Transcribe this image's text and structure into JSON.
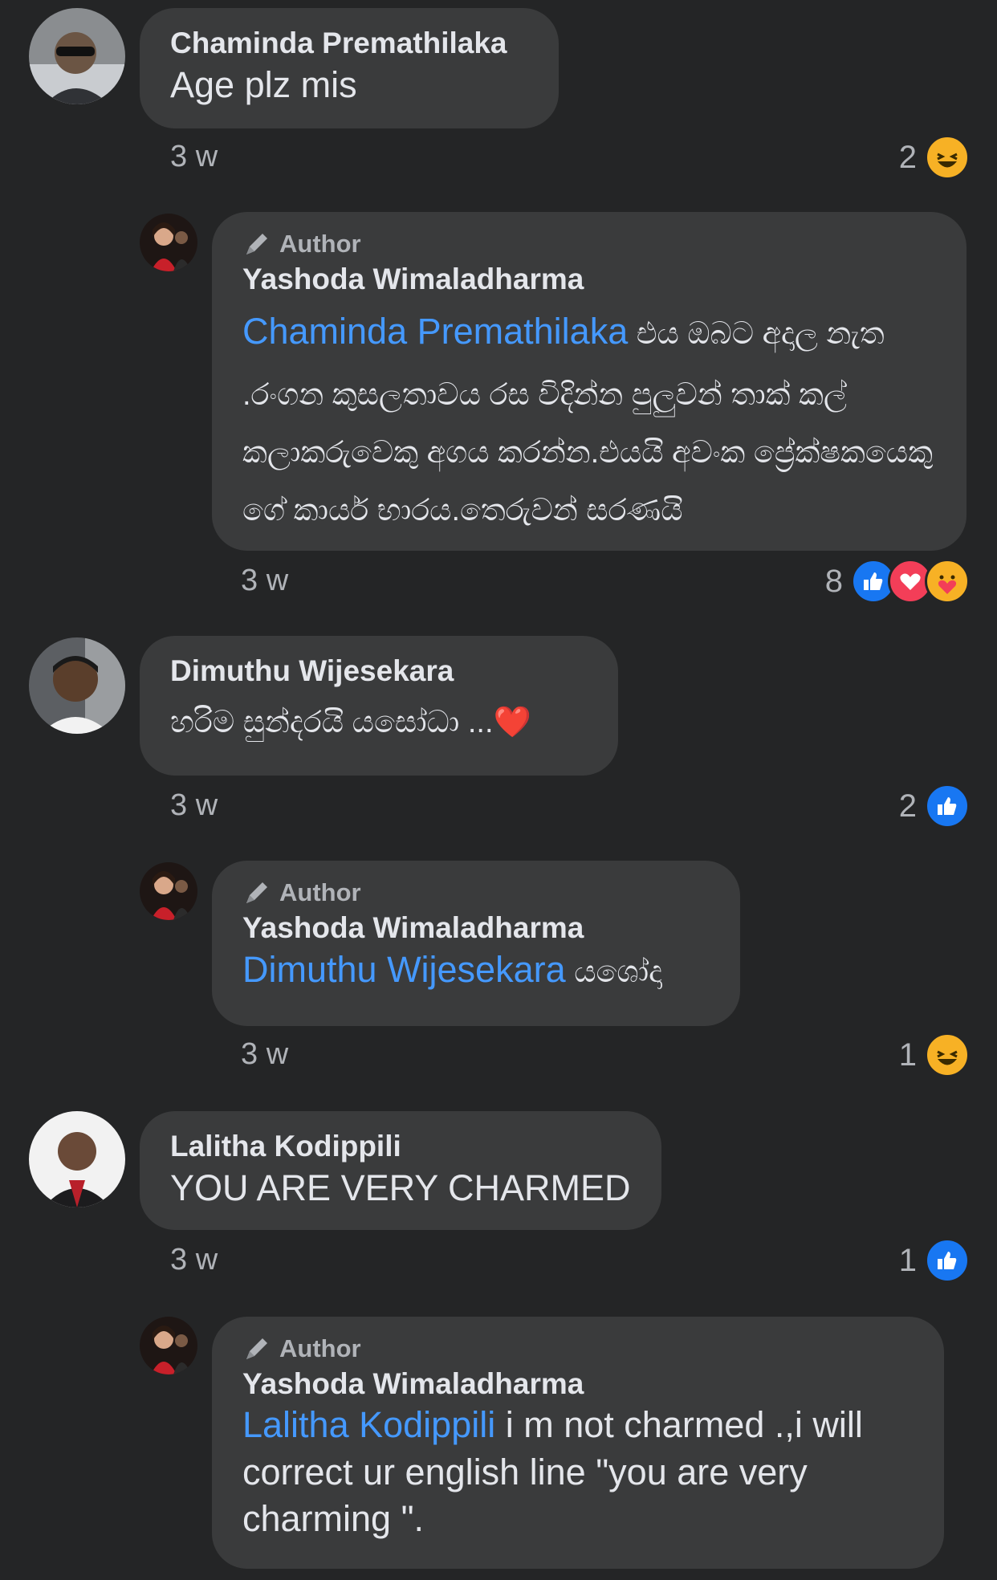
{
  "comments": [
    {
      "author": "Chaminda Premathilaka",
      "text": "Age plz mis",
      "time": "3 w",
      "reaction_count": "2",
      "reactions": [
        "haha-icon"
      ]
    },
    {
      "badge": "Author",
      "author": "Yashoda Wimaladharma",
      "mention": "Chaminda Premathilaka",
      "text": " එය ඔබට අදාල නැත .රංගන කුසලතාවය රස විදින්න පුලුවන් තාක් කල් කලාකරුවෙකු අගය කරන්න.එයයි අවංක ප්‍රේක්ෂකයෙකු ගේ කාර්ය භාරය.තෙරුවන් සරණයි",
      "time": "3 w",
      "reaction_count": "8",
      "reactions": [
        "like-icon",
        "love-icon",
        "care-icon"
      ]
    },
    {
      "author": "Dimuthu Wijesekara",
      "text": "හරිම සුන්දරයි යසෝධා ...❤️",
      "time": "3 w",
      "reaction_count": "2",
      "reactions": [
        "like-icon"
      ]
    },
    {
      "badge": "Author",
      "author": "Yashoda Wimaladharma",
      "mention": "Dimuthu Wijesekara",
      "text": " යශෝදා",
      "time": "3 w",
      "reaction_count": "1",
      "reactions": [
        "haha-icon"
      ]
    },
    {
      "author": "Lalitha Kodippili",
      "text": "YOU ARE VERY CHARMED",
      "time": "3 w",
      "reaction_count": "1",
      "reactions": [
        "like-icon"
      ]
    },
    {
      "badge": "Author",
      "author": "Yashoda Wimaladharma",
      "mention": "Lalitha Kodippili",
      "text": " i m not charmed .,i will correct ur english line \"you are very charming \".",
      "time": "",
      "reaction_count": "",
      "reactions": []
    }
  ],
  "colors": {
    "background": "#242526",
    "bubble": "#3a3b3c",
    "mention": "#4599ff",
    "like": "#1877f2",
    "love": "#f33e58",
    "haha": "#f7b125"
  }
}
